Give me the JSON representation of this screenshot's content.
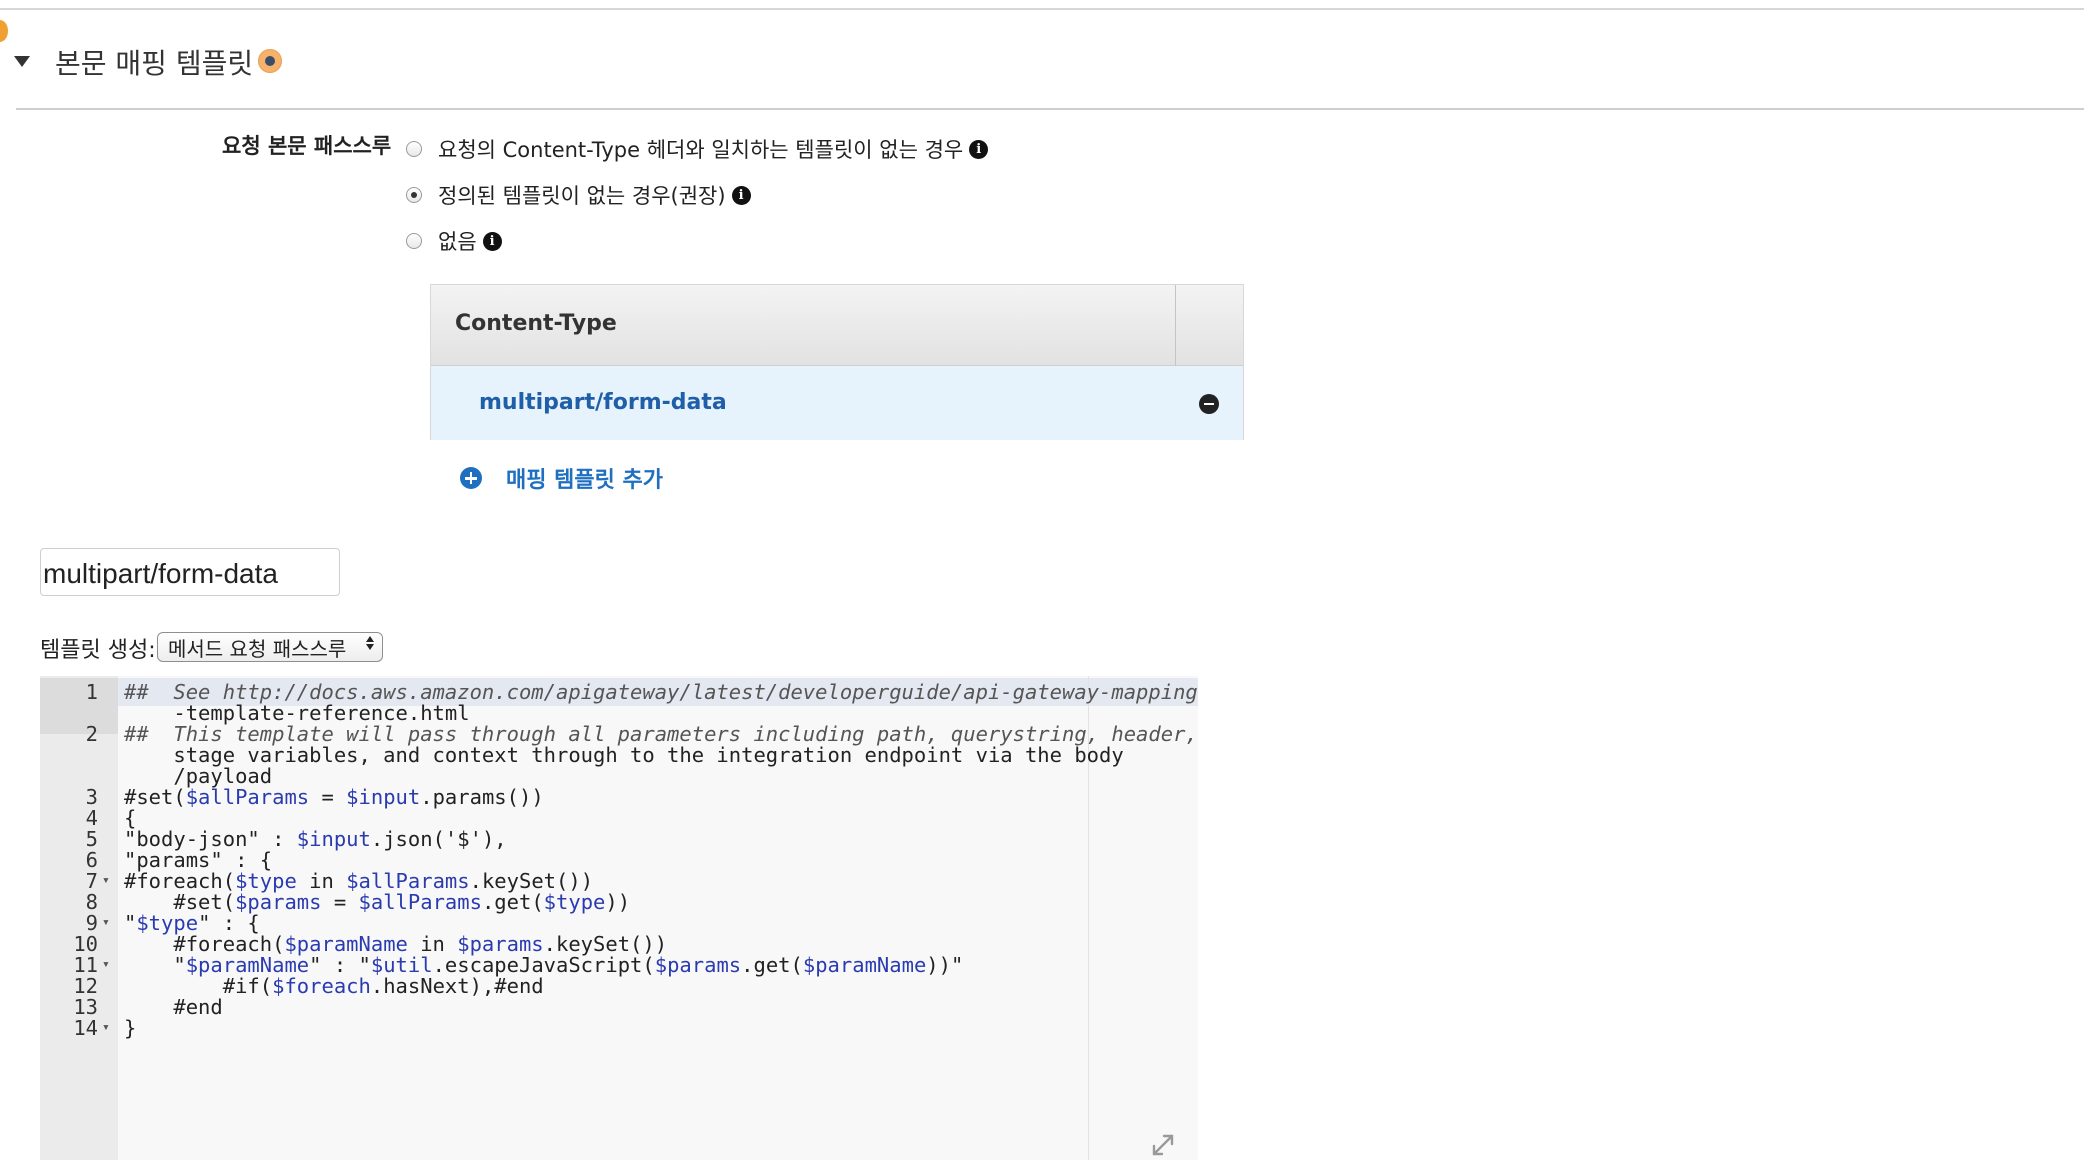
{
  "section": {
    "title": "본문 매핑 템플릿"
  },
  "passthrough": {
    "label": "요청 본문 패스스루",
    "options": [
      {
        "label": "요청의 Content-Type 헤더와 일치하는 템플릿이 없는 경우",
        "checked": false
      },
      {
        "label": "정의된 템플릿이 없는 경우(권장)",
        "checked": true
      },
      {
        "label": "없음",
        "checked": false
      }
    ]
  },
  "content_type_table": {
    "header": "Content-Type",
    "rows": [
      "multipart/form-data"
    ],
    "add_label": "매핑 템플릿 추가"
  },
  "template_name": {
    "value": "multipart/form-data"
  },
  "generate": {
    "label": "템플릿 생성:",
    "selected": "메서드 요청 패스스루"
  },
  "editor": {
    "lines": [
      {
        "n": "1",
        "fold": false,
        "text": "##  See http://docs.aws.amazon.com/apigateway/latest/developerguide/api-gateway-mapping"
      },
      {
        "n": "",
        "fold": false,
        "text": "    -template-reference.html"
      },
      {
        "n": "2",
        "fold": false,
        "text": "##  This template will pass through all parameters including path, querystring, header,"
      },
      {
        "n": "",
        "fold": false,
        "text": "    stage variables, and context through to the integration endpoint via the body"
      },
      {
        "n": "",
        "fold": false,
        "text": "    /payload"
      },
      {
        "n": "3",
        "fold": false,
        "text": "#set($allParams = $input.params())"
      },
      {
        "n": "4",
        "fold": false,
        "text": "{"
      },
      {
        "n": "5",
        "fold": false,
        "text": "\"body-json\" : $input.json('$'),"
      },
      {
        "n": "6",
        "fold": false,
        "text": "\"params\" : {"
      },
      {
        "n": "7",
        "fold": true,
        "text": "#foreach($type in $allParams.keySet())"
      },
      {
        "n": "8",
        "fold": false,
        "text": "    #set($params = $allParams.get($type))"
      },
      {
        "n": "9",
        "fold": true,
        "text": "\"$type\" : {"
      },
      {
        "n": "10",
        "fold": false,
        "text": "    #foreach($paramName in $params.keySet())"
      },
      {
        "n": "11",
        "fold": true,
        "text": "    \"$paramName\" : \"$util.escapeJavaScript($params.get($paramName))\""
      },
      {
        "n": "12",
        "fold": false,
        "text": "        #if($foreach.hasNext),#end"
      },
      {
        "n": "13",
        "fold": false,
        "text": "    #end"
      },
      {
        "n": "14",
        "fold": true,
        "text": "}"
      }
    ]
  }
}
